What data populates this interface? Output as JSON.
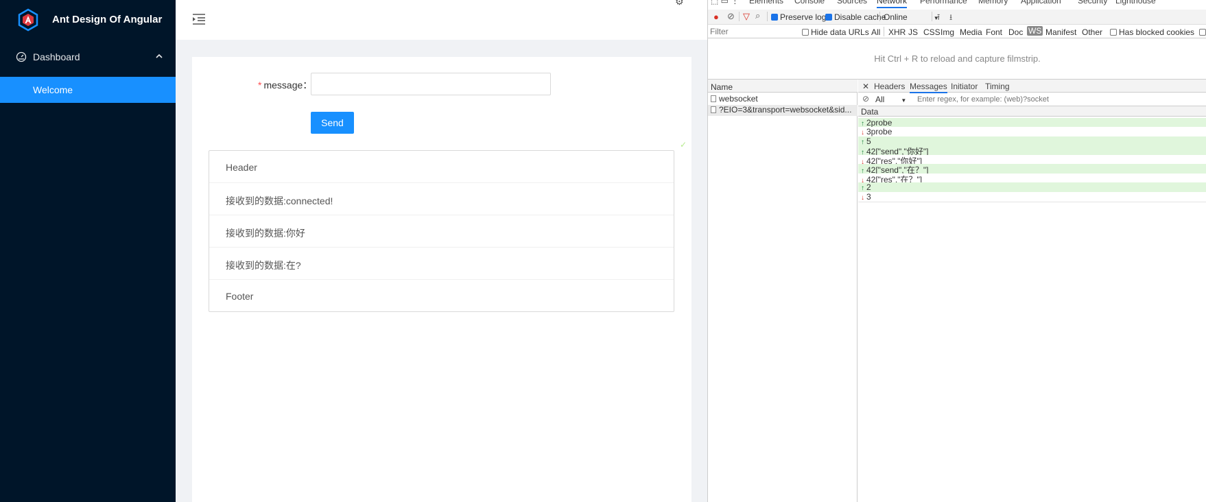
{
  "app": {
    "logo_text": "Ant Design Of Angular",
    "menu": {
      "dashboard_label": "Dashboard",
      "welcome_label": "Welcome"
    },
    "brand_color": "#1890ff",
    "sider_color": "#001529"
  },
  "form": {
    "required_mark": "*",
    "message_label": "message",
    "message_value": "",
    "send_label": "Send"
  },
  "list": {
    "header": "Header",
    "items": [
      "接收到的数据:connected!",
      "接收到的数据:你好",
      "接收到的数据:在?"
    ],
    "footer": "Footer"
  },
  "devtools": {
    "tabs": [
      "Elements",
      "Console",
      "Sources",
      "Network",
      "Performance",
      "Memory",
      "Application",
      "Security",
      "Lighthouse"
    ],
    "active_tab": "Network",
    "toolbar": {
      "preserve_log": "Preserve log",
      "disable_cache": "Disable cache",
      "throttle": "Online"
    },
    "filter": {
      "placeholder": "Filter",
      "hide_data_urls": "Hide data URLs",
      "types": [
        "All",
        "XHR",
        "JS",
        "CSS",
        "Img",
        "Media",
        "Font",
        "Doc",
        "WS",
        "Manifest",
        "Other"
      ],
      "active_type": "WS",
      "has_blocked_cookies": "Has blocked cookies"
    },
    "filmstrip_message": "Hit Ctrl + R to reload and capture filmstrip.",
    "name_header": "Name",
    "requests": [
      "websocket",
      "?EIO=3&transport=websocket&sid..."
    ],
    "detail_tabs": [
      "Headers",
      "Messages",
      "Initiator",
      "Timing"
    ],
    "active_detail_tab": "Messages",
    "messages_filter": {
      "type": "All",
      "placeholder": "Enter regex, for example: (web)?socket"
    },
    "data_header": "Data",
    "frames": [
      {
        "dir": "sent",
        "text": "2probe"
      },
      {
        "dir": "recv",
        "text": "3probe"
      },
      {
        "dir": "sent",
        "text": "5"
      },
      {
        "dir": "sent",
        "text": "42[\"send\",\"你好\"]"
      },
      {
        "dir": "recv",
        "text": "42[\"res\",\"你好\"]"
      },
      {
        "dir": "sent",
        "text": "42[\"send\",\"在？\"]"
      },
      {
        "dir": "recv",
        "text": "42[\"res\",\"在？\"]"
      },
      {
        "dir": "sent",
        "text": "2"
      },
      {
        "dir": "recv",
        "text": "3"
      }
    ]
  }
}
